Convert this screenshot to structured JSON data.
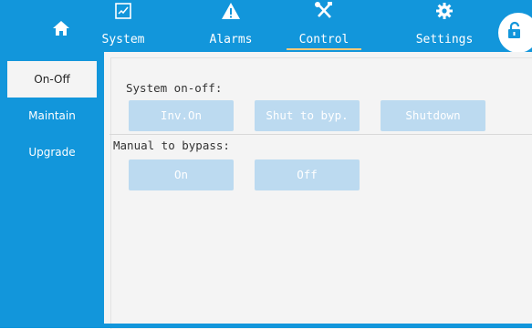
{
  "topbar": {
    "home_icon": "home-icon",
    "tabs": [
      {
        "label": "System",
        "icon": "chart-icon"
      },
      {
        "label": "Alarms",
        "icon": "warning-icon"
      },
      {
        "label": "Control",
        "icon": "tools-icon",
        "active": true
      },
      {
        "label": "Settings",
        "icon": "gear-icon"
      }
    ],
    "lock_icon": "unlock-icon"
  },
  "sidebar": {
    "items": [
      {
        "label": "On-Off",
        "active": true
      },
      {
        "label": "Maintain"
      },
      {
        "label": "Upgrade"
      }
    ]
  },
  "main": {
    "system_onoff": {
      "label": "System on-off:",
      "buttons": [
        "Inv.On",
        "Shut to byp.",
        "Shutdown"
      ]
    },
    "manual_bypass": {
      "label": "Manual to bypass:",
      "buttons": [
        "On",
        "Off"
      ]
    }
  },
  "colors": {
    "primary": "#1296db",
    "button_disabled": "#bcdaf0",
    "active_underline": "#f3c97a",
    "content_bg": "#f4f4f4"
  }
}
